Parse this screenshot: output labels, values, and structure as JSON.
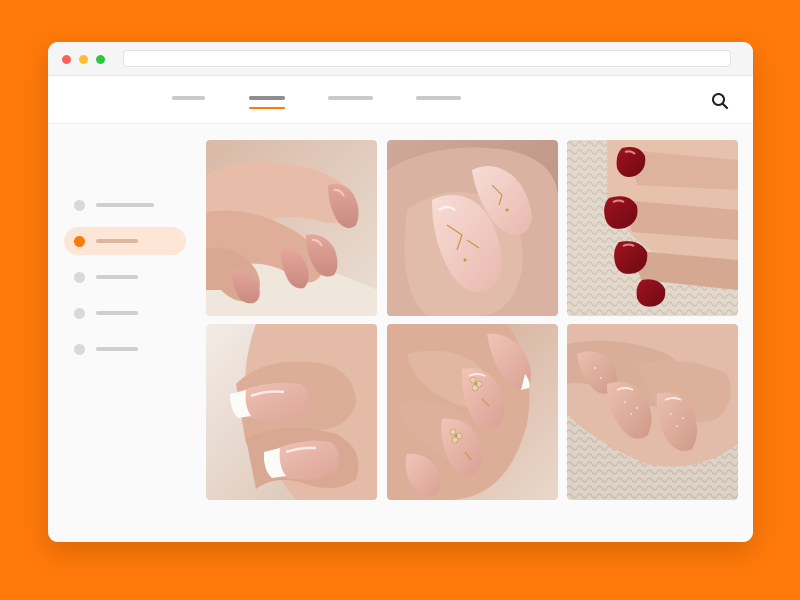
{
  "app": {
    "background_color": "#ff7a0a",
    "accent_color": "#ff7a0a",
    "window_controls": {
      "close_color": "#ff5f57",
      "minimize_color": "#febc2e",
      "maximize_color": "#28c840"
    },
    "address_bar": {
      "value": ""
    }
  },
  "nav": {
    "tabs": [
      {
        "id": "tab-1",
        "label": "",
        "active": false
      },
      {
        "id": "tab-2",
        "label": "",
        "active": true
      },
      {
        "id": "tab-3",
        "label": "",
        "active": false
      },
      {
        "id": "tab-4",
        "label": "",
        "active": false
      }
    ],
    "search_icon": "search-icon"
  },
  "sidebar": {
    "items": [
      {
        "label": "",
        "active": false
      },
      {
        "label": "",
        "active": true
      },
      {
        "label": "",
        "active": false
      },
      {
        "label": "",
        "active": false
      },
      {
        "label": "",
        "active": false
      }
    ]
  },
  "gallery": {
    "images": [
      {
        "subject": "nude-almond-nails"
      },
      {
        "subject": "marble-gold-fleck-nails"
      },
      {
        "subject": "deep-red-nails-on-knit"
      },
      {
        "subject": "french-tip-nails"
      },
      {
        "subject": "gold-flower-nail-art"
      },
      {
        "subject": "shimmer-nude-nails-on-knit"
      }
    ]
  }
}
